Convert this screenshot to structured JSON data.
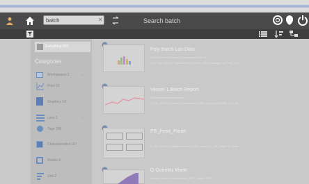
{
  "toolbar": {
    "search_value": "batch",
    "window_title": "Search batch"
  },
  "sidebar": {
    "everything": "Everything 567",
    "heading": "Categories",
    "items": [
      {
        "label": "Workspaces 2",
        "icon": "workspace-icon"
      },
      {
        "label": "Plots 21",
        "icon": "plot-icon"
      },
      {
        "label": "Graphics 14",
        "icon": "graphics-icon"
      },
      {
        "label": "Lists 2",
        "icon": "list-icon"
      },
      {
        "label": "Tags 250",
        "icon": "tag-icon"
      },
      {
        "label": "Characteristics 117",
        "icon": "characteristics-icon"
      },
      {
        "label": "Assets 9",
        "icon": "asset-icon"
      },
      {
        "label": "Unit 2",
        "icon": "unit-icon"
      }
    ]
  },
  "results": [
    {
      "title": "Poly Batch Lab Data",
      "path": "/Demo Material/Emulator Calculations/Part III",
      "meta": "Lab_Poly_C[AD] | Polymer Melting Point | MES | Analog_Lab_Poly_D43...",
      "thumb_icon": "bar-chart-thumbnail"
    },
    {
      "title": "Vessel 1 Batch Report",
      "path": "/Polymers/Vessels/Vessel 1",
      "meta": "T_PB_V01.PV | Vessel 1 temperature | MES | Analog | EVENT | PF_Stk...",
      "thumb_icon": "trend-thumbnail"
    },
    {
      "title": "PB_Feed_Panel",
      "path": "",
      "meta": "F_PB_AddA.PV | Additive A flow | MES | Analog F_PB_AddB.PV | Addit...",
      "thumb_icon": "panel-thumbnail"
    },
    {
      "title": "Q Quantity Made",
      "path": "",
      "meta": "quantity made standard batch | MES | Batch SPC",
      "thumb_icon": "area-chart-thumbnail"
    }
  ]
}
